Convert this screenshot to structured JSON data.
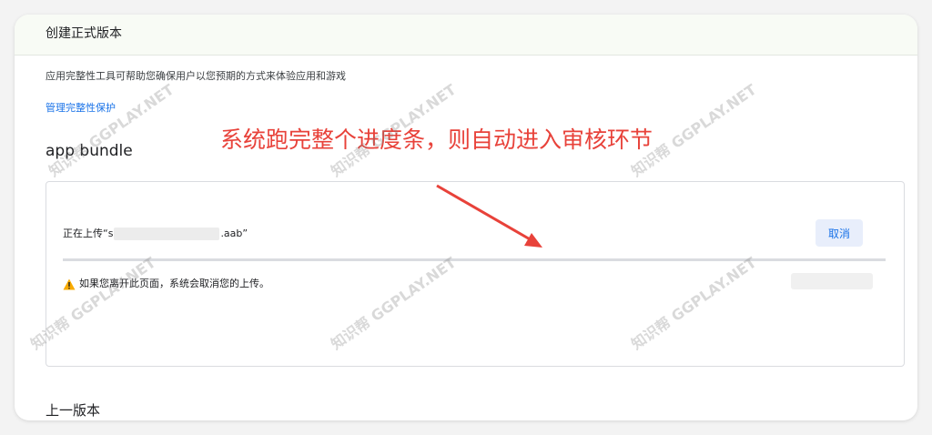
{
  "header": {
    "title": "创建正式版本"
  },
  "integrity": {
    "description": "应用完整性工具可帮助您确保用户以您预期的方式来体验应用和游戏",
    "manage_link": "管理完整性保护"
  },
  "bundle": {
    "title": "app bundle"
  },
  "annotation": {
    "text": "系统跑完整个进度条，则自动进入审核环节",
    "color": "#e8423a"
  },
  "upload": {
    "prefix": "正在上传“s",
    "suffix": ".aab”",
    "cancel_label": "取消",
    "warning": "如果您离开此页面，系统会取消您的上传。",
    "progress": 0.0
  },
  "previous": {
    "title": "上一版本"
  },
  "watermark": {
    "text": "知识帮 GGPLAY.NET"
  },
  "icons": {
    "warning": "warning-triangle-icon"
  },
  "colors": {
    "accent": "#1a73e8",
    "warning_icon": "#f9ab00"
  }
}
